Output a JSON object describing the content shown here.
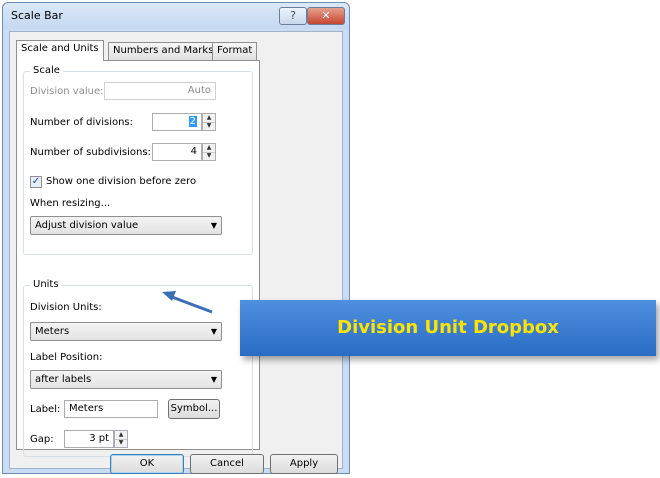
{
  "window": {
    "title": "Scale Bar",
    "help_label": "?",
    "close_label": "✕"
  },
  "tabs": [
    {
      "label": "Scale and Units",
      "active": true
    },
    {
      "label": "Numbers and Marks",
      "active": false
    },
    {
      "label": "Format",
      "active": false
    }
  ],
  "scale": {
    "legend": "Scale",
    "division_value_label": "Division value:",
    "division_value": "Auto",
    "num_divisions_label": "Number of divisions:",
    "num_divisions": "2",
    "num_subdivisions_label": "Number of subdivisions:",
    "num_subdivisions": "4",
    "show_one_division_label": "Show one division before zero",
    "show_one_division_checked": true,
    "when_resizing_label": "When resizing...",
    "when_resizing_value": "Adjust division value"
  },
  "units": {
    "legend": "Units",
    "division_units_label": "Division Units:",
    "division_units_value": "Meters",
    "label_position_label": "Label Position:",
    "label_position_value": "after labels",
    "label_label": "Label:",
    "label_value": "Meters",
    "symbol_button": "Symbol...",
    "gap_label": "Gap:",
    "gap_value": "3 pt"
  },
  "buttons": {
    "ok": "OK",
    "cancel": "Cancel",
    "apply": "Apply"
  },
  "annotation": {
    "callout_text": "Division Unit Dropbox"
  },
  "colors": {
    "callout_bg": "#2a6cc4",
    "callout_text": "#ffe400",
    "arrow": "#3a6fb5"
  }
}
